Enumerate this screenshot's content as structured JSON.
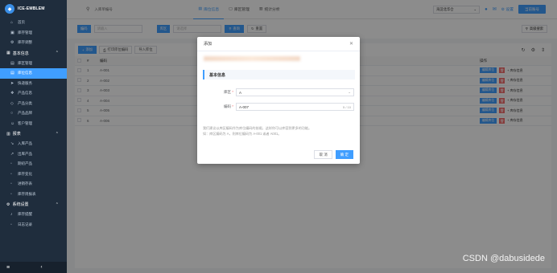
{
  "brand": {
    "name": "ICE-EMBLEM"
  },
  "sidebar": {
    "top_items": [
      {
        "label": "首页",
        "icon": "home-icon"
      },
      {
        "label": "库存管理",
        "icon": "box-icon"
      },
      {
        "label": "库存调整",
        "icon": "adjust-icon"
      }
    ],
    "group1": {
      "label": "基本信息"
    },
    "group1_items": [
      {
        "label": "库区管理",
        "icon": "area-icon",
        "active": false
      },
      {
        "label": "库位信息",
        "icon": "location-icon",
        "active": true
      },
      {
        "label": "快递服务",
        "icon": "truck-icon",
        "active": false
      },
      {
        "label": "产品信息",
        "icon": "product-icon",
        "active": false
      },
      {
        "label": "产品分类",
        "icon": "category-icon",
        "active": false
      },
      {
        "label": "产品品牌",
        "icon": "brand-icon",
        "active": false
      },
      {
        "label": "客户管理",
        "icon": "customer-icon",
        "active": false
      }
    ],
    "group2": {
      "label": "报表"
    },
    "group2_items": [
      {
        "label": "入库产品",
        "icon": "in-icon"
      },
      {
        "label": "出库产品",
        "icon": "out-icon"
      },
      {
        "label": "期初产品",
        "icon": "init-icon"
      },
      {
        "label": "库存变化",
        "icon": "change-icon"
      },
      {
        "label": "进销存表",
        "icon": "table-icon"
      },
      {
        "label": "库存周报表",
        "icon": "report-icon"
      }
    ],
    "group3": {
      "label": "系统设置"
    },
    "group3_items": [
      {
        "label": "库存提醒",
        "icon": "bell-icon"
      },
      {
        "label": "日志记录",
        "icon": "log-icon"
      }
    ]
  },
  "topbar": {
    "search_placeholder": "入库单编号",
    "tabs": [
      {
        "label": "库位信息",
        "active": true
      },
      {
        "label": "库区管理",
        "active": false
      },
      {
        "label": "统计分析",
        "active": false
      }
    ],
    "warehouse": "海淀北华仓",
    "settings_label": "设置",
    "user_label": "当前账号"
  },
  "filter": {
    "code_label": "编码",
    "code_placeholder": "请输入",
    "area_label": "库区",
    "area_placeholder": "请选择",
    "query_label": "查询",
    "reset_label": "重置",
    "advanced_label": "高级搜索"
  },
  "toolbar": {
    "add_label": "添加",
    "print_label": "打印库位编码",
    "import_label": "导入库位"
  },
  "table": {
    "columns": [
      "#",
      "编码",
      "操作"
    ],
    "rows": [
      {
        "no": "1",
        "code": "A-001"
      },
      {
        "no": "2",
        "code": "A-002"
      },
      {
        "no": "3",
        "code": "A-003"
      },
      {
        "no": "4",
        "code": "A-004"
      },
      {
        "no": "5",
        "code": "A-005"
      },
      {
        "no": "6",
        "code": "A-006"
      }
    ],
    "edit_label": "编辑库位",
    "more_label": "+ 库存信息"
  },
  "modal": {
    "title": "添加",
    "section_title": "基本信息",
    "area_label": "库区",
    "area_value": "A",
    "code_label": "编码",
    "code_value": "A-007",
    "code_count": "5 / 10",
    "hint_line1": "我们建议以库区编码作为库位编码的前缀，这样你可以库容到更多的功能。",
    "hint_line2": "如：库区编码为 A，则库位编码为 A-001 或者 A001。",
    "cancel_label": "取 消",
    "confirm_label": "确 定"
  },
  "watermark": "CSDN @dabusidede"
}
